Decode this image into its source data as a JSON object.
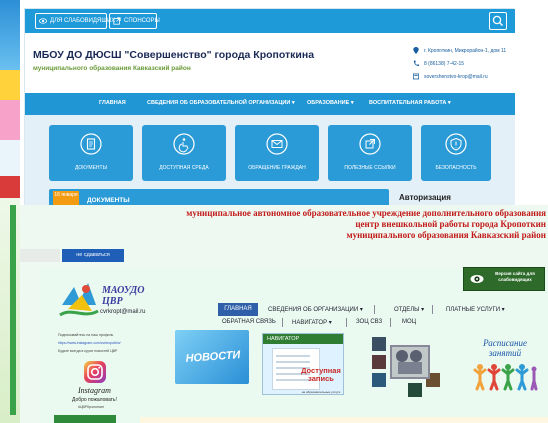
{
  "site1": {
    "topbar": {
      "eye_btn_label": "ДЛЯ СЛАБОВИДЯЩИХ",
      "sponsor_btn_label": "СПОНСОРЫ"
    },
    "title": "МБОУ ДО ДЮСШ \"Совершенство\" города Кропоткина",
    "subtitle": "муниципального образования Кавказский район",
    "contacts": [
      "г. Кропоткин, Микрорайон-1, дом 11",
      "8 (86138) 7-42-15",
      "sovershenstvo-krop@mail.ru"
    ],
    "nav": [
      "ГЛАВНАЯ",
      "СВЕДЕНИЯ ОБ ОБРАЗОВАТЕЛЬНОЙ ОРГАНИЗАЦИИ ▾",
      "ОБРАЗОВАНИЕ ▾",
      "ВОСПИТАТЕЛЬНАЯ РАБОТА ▾"
    ],
    "tiles": [
      {
        "label": "ДОКУМЕНТЫ",
        "icon": "document-icon"
      },
      {
        "label": "ДОСТУПНАЯ СРЕДА",
        "icon": "accessibility-icon"
      },
      {
        "label": "ОБРАЩЕНИЕ ГРАЖДАН",
        "icon": "mail-icon"
      },
      {
        "label": "ПОЛЕЗНЫЕ ССЫЛКИ",
        "icon": "link-icon"
      },
      {
        "label": "БЕЗОПАСНОСТЬ",
        "icon": "shield-icon"
      }
    ],
    "doc_badge": "16 января",
    "doc_label": "ДОКУМЕНТЫ",
    "auth_label": "Авторизация",
    "accent": "#1f9ad8"
  },
  "site2": {
    "heading_line1": "муниципальное автономное образовательное учреждение дополнительного образования",
    "heading_line2": "центр внешкольной работы города Кропоткин",
    "heading_line3": "муниципального образования Кавказский район",
    "blue_btn": "не сдаваться",
    "version_box": "Версия сайта для слабовидящих",
    "logo_title_1": "МАОУДО",
    "logo_title_2": "ЦВР",
    "logo_email": "cvrkropt@mail.ru",
    "menu": [
      "ГЛАВНАЯ",
      "СВЕДЕНИЯ ОБ ОРГАНИЗАЦИИ ▾",
      "ОТДЕЛЫ ▾",
      "ПЛАТНЫЕ УСЛУГИ ▾",
      "ОБРАТНАЯ СВЯЗЬ",
      "НАВИГАТОР ▾",
      "ЗОЦ СВЗ",
      "МОЦ"
    ],
    "side_text_1": "Подписывайтесь на наш профиль",
    "side_text_2": "https://www.instagram.com/cvrkropotkin/",
    "side_text_3": "Будьте всегда в курсе новостей ЦВР",
    "insta_label": "Instagram",
    "welcome": "Добро пожаловать!",
    "hashtag": "#ЦВРКропоткин",
    "news_label": "НОВОСТИ",
    "navigator_head": "НАВИГАТОР",
    "navigator_dost": "Доступная запись",
    "navigator_small": "на образовательные услуги",
    "schedule_title": "Расписание занятий",
    "heading_color": "#c21a1a"
  }
}
